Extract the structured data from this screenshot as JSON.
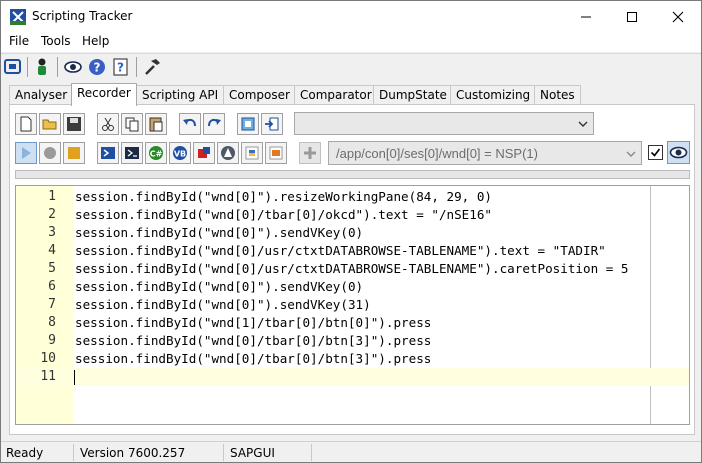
{
  "window": {
    "title": "Scripting Tracker"
  },
  "menu": {
    "items": [
      "File",
      "Tools",
      "Help"
    ]
  },
  "toolbar": {
    "icons": [
      "connection-tree-icon",
      "user-icon",
      "eye-icon",
      "help-icon",
      "help-book-icon",
      "hammer-icon"
    ]
  },
  "tabs": {
    "items": [
      "Analyser",
      "Recorder",
      "Scripting API",
      "Composer",
      "Comparator",
      "DumpState",
      "Customizing",
      "Notes"
    ],
    "active": "Recorder"
  },
  "recorder": {
    "toolbar1_icons": [
      "new-file-icon",
      "open-folder-icon",
      "save-icon",
      "cut-icon",
      "copy-icon",
      "paste-icon",
      "undo-icon",
      "redo-icon",
      "copy-to-clipboard-icon",
      "export-icon"
    ],
    "toolbar2_icons": [
      "play-icon",
      "record-icon",
      "stop-icon",
      "powershell-icon",
      "console-icon",
      "csharp-icon",
      "vb-icon",
      "c-icon",
      "autoit-icon",
      "python-icon",
      "sap-icon"
    ],
    "script_language_combo": "",
    "path": "/app/con[0]/ses[0]/wnd[0] = NSP(1)",
    "checkbox_checked": true
  },
  "editor": {
    "lines": [
      {
        "num": "1",
        "code": "session.findById(\"wnd[0]\").resizeWorkingPane(84, 29, 0)"
      },
      {
        "num": "2",
        "code": "session.findById(\"wnd[0]/tbar[0]/okcd\").text = \"/nSE16\""
      },
      {
        "num": "3",
        "code": "session.findById(\"wnd[0]\").sendVKey(0)"
      },
      {
        "num": "4",
        "code": "session.findById(\"wnd[0]/usr/ctxtDATABROWSE-TABLENAME\").text = \"TADIR\""
      },
      {
        "num": "5",
        "code": "session.findById(\"wnd[0]/usr/ctxtDATABROWSE-TABLENAME\").caretPosition = 5"
      },
      {
        "num": "6",
        "code": "session.findById(\"wnd[0]\").sendVKey(0)"
      },
      {
        "num": "7",
        "code": "session.findById(\"wnd[0]\").sendVKey(31)"
      },
      {
        "num": "8",
        "code": "session.findById(\"wnd[1]/tbar[0]/btn[0]\").press"
      },
      {
        "num": "9",
        "code": "session.findById(\"wnd[0]/tbar[0]/btn[3]\").press"
      },
      {
        "num": "10",
        "code": "session.findById(\"wnd[0]/tbar[0]/btn[3]\").press"
      },
      {
        "num": "11",
        "code": ""
      }
    ]
  },
  "status": {
    "state": "Ready",
    "version": "Version 7600.257",
    "system": "SAPGUI"
  },
  "colors": {
    "gutter": "#ffffd8",
    "current_line": "#ffffe0",
    "accent": "#0078d7"
  }
}
